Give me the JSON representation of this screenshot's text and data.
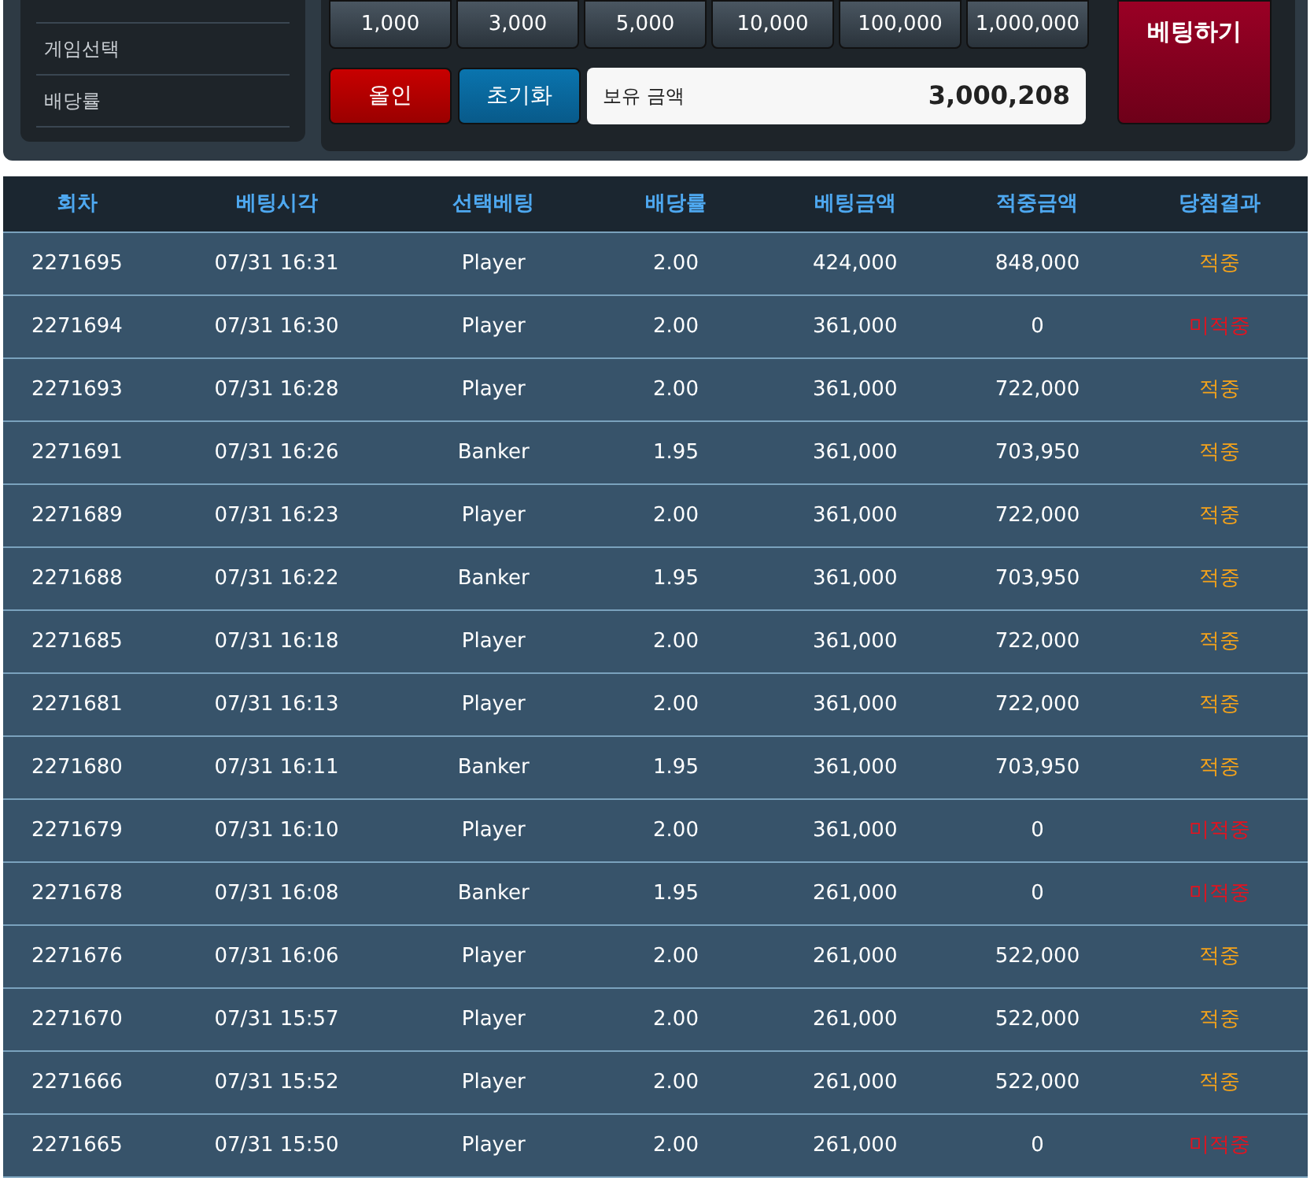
{
  "sidebar": {
    "items": [
      "게임선택",
      "배당률"
    ]
  },
  "chips": [
    "1,000",
    "3,000",
    "5,000",
    "10,000",
    "100,000",
    "1,000,000"
  ],
  "actions": {
    "all_in": "올인",
    "reset": "초기화",
    "bet": "베팅하기"
  },
  "balance": {
    "label": "보유 금액",
    "value": "3,000,208"
  },
  "table": {
    "columns": [
      "회차",
      "베팅시각",
      "선택베팅",
      "배당률",
      "베팅금액",
      "적중금액",
      "당첨결과"
    ],
    "rows": [
      {
        "cells": [
          "2271695",
          "07/31 16:31",
          "Player",
          "2.00",
          "424,000",
          "848,000",
          "적중"
        ],
        "kind": "win"
      },
      {
        "cells": [
          "2271694",
          "07/31 16:30",
          "Player",
          "2.00",
          "361,000",
          "0",
          "미적중"
        ],
        "kind": "lose"
      },
      {
        "cells": [
          "2271693",
          "07/31 16:28",
          "Player",
          "2.00",
          "361,000",
          "722,000",
          "적중"
        ],
        "kind": "win"
      },
      {
        "cells": [
          "2271691",
          "07/31 16:26",
          "Banker",
          "1.95",
          "361,000",
          "703,950",
          "적중"
        ],
        "kind": "win"
      },
      {
        "cells": [
          "2271689",
          "07/31 16:23",
          "Player",
          "2.00",
          "361,000",
          "722,000",
          "적중"
        ],
        "kind": "win"
      },
      {
        "cells": [
          "2271688",
          "07/31 16:22",
          "Banker",
          "1.95",
          "361,000",
          "703,950",
          "적중"
        ],
        "kind": "win"
      },
      {
        "cells": [
          "2271685",
          "07/31 16:18",
          "Player",
          "2.00",
          "361,000",
          "722,000",
          "적중"
        ],
        "kind": "win"
      },
      {
        "cells": [
          "2271681",
          "07/31 16:13",
          "Player",
          "2.00",
          "361,000",
          "722,000",
          "적중"
        ],
        "kind": "win"
      },
      {
        "cells": [
          "2271680",
          "07/31 16:11",
          "Banker",
          "1.95",
          "361,000",
          "703,950",
          "적중"
        ],
        "kind": "win"
      },
      {
        "cells": [
          "2271679",
          "07/31 16:10",
          "Player",
          "2.00",
          "361,000",
          "0",
          "미적중"
        ],
        "kind": "lose"
      },
      {
        "cells": [
          "2271678",
          "07/31 16:08",
          "Banker",
          "1.95",
          "261,000",
          "0",
          "미적중"
        ],
        "kind": "lose"
      },
      {
        "cells": [
          "2271676",
          "07/31 16:06",
          "Player",
          "2.00",
          "261,000",
          "522,000",
          "적중"
        ],
        "kind": "win"
      },
      {
        "cells": [
          "2271670",
          "07/31 15:57",
          "Player",
          "2.00",
          "261,000",
          "522,000",
          "적중"
        ],
        "kind": "win"
      },
      {
        "cells": [
          "2271666",
          "07/31 15:52",
          "Player",
          "2.00",
          "261,000",
          "522,000",
          "적중"
        ],
        "kind": "win"
      },
      {
        "cells": [
          "2271665",
          "07/31 15:50",
          "Player",
          "2.00",
          "261,000",
          "0",
          "미적중"
        ],
        "kind": "lose"
      }
    ]
  }
}
